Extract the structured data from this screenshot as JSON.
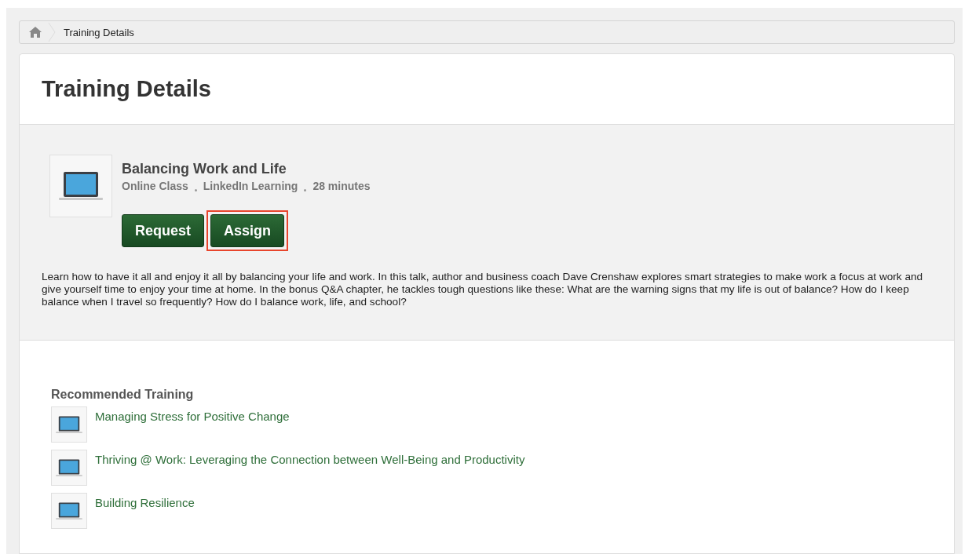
{
  "breadcrumb": {
    "items": [
      "Training Details"
    ]
  },
  "page": {
    "title": "Training Details"
  },
  "course": {
    "title": "Balancing Work and Life",
    "meta": [
      "Online Class",
      "LinkedIn Learning",
      "28 minutes"
    ],
    "buttons": [
      {
        "label": "Request",
        "highlighted": false
      },
      {
        "label": "Assign",
        "highlighted": true
      }
    ],
    "description": "Learn how to have it all and enjoy it all by balancing your life and work. In this talk, author and business coach Dave Crenshaw explores smart strategies to make work a focus at work and give yourself time to enjoy your time at home. In the bonus Q&A chapter, he tackles tough questions like these: What are the warning signs that my life is out of balance? How do I keep balance when I travel so frequently? How do I balance work, life, and school?"
  },
  "recommended": {
    "heading": "Recommended Training",
    "items": [
      "Managing Stress for Positive Change",
      "Thriving @ Work: Leveraging the Connection between Well-Being and Productivity",
      "Building Resilience"
    ]
  }
}
